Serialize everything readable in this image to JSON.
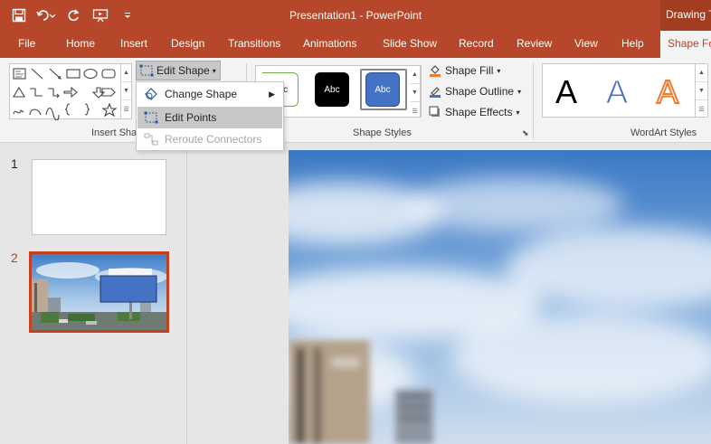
{
  "titlebar": {
    "document_title": "Presentation1  -  PowerPoint",
    "contextual_tab_group": "Drawing Tools"
  },
  "qat": {
    "save": "save-icon",
    "undo": "undo-icon",
    "redo": "redo-icon",
    "present": "present-from-beginning-icon",
    "customize": "customize-qat-icon"
  },
  "tabs": [
    "File",
    "Home",
    "Insert",
    "Design",
    "Transitions",
    "Animations",
    "Slide Show",
    "Record",
    "Review",
    "View",
    "Help",
    "Shape Format"
  ],
  "ribbon": {
    "insert_shapes_label": "Insert Shapes",
    "edit_shape_label": "Edit Shape",
    "shape_styles_label": "Shape Styles",
    "style_swatch_text": "Abc",
    "shape_fill": "Shape Fill",
    "shape_outline": "Shape Outline",
    "shape_effects": "Shape Effects",
    "wordart_styles_label": "WordArt Styles",
    "wordart_letter": "A"
  },
  "edit_shape_menu": {
    "items": [
      {
        "label": "Change Shape",
        "has_submenu": true,
        "state": "normal"
      },
      {
        "label": "Edit Points",
        "state": "highlighted"
      },
      {
        "label": "Reroute Connectors",
        "state": "disabled"
      }
    ]
  },
  "thumbnails": [
    {
      "number": "1",
      "selected": false
    },
    {
      "number": "2",
      "selected": true
    }
  ],
  "colors": {
    "brand": "#b7472a",
    "selection": "#c4401f",
    "shape_blue": "#4472c4",
    "wordart_orange": "#ed7d31"
  }
}
